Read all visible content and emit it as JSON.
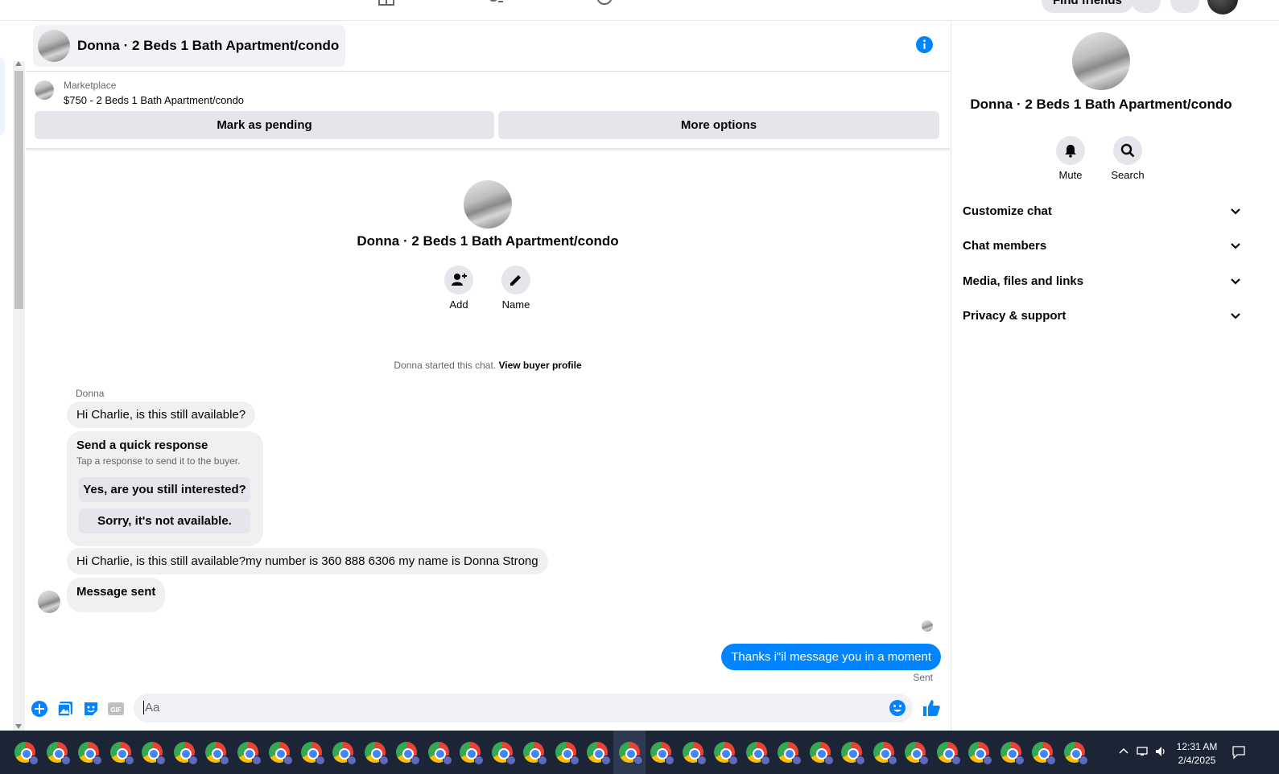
{
  "topbar": {
    "find_friends": "Find friends"
  },
  "header": {
    "title": "Donna · 2 Beds 1 Bath Apartment/condo"
  },
  "marketplace": {
    "label": "Marketplace",
    "listing": "$750 - 2 Beds 1 Bath Apartment/condo",
    "mark_pending": "Mark as pending",
    "more_options": "More options"
  },
  "intro": {
    "name": "Donna · 2 Beds 1 Bath Apartment/condo",
    "add_label": "Add",
    "name_label": "Name",
    "started_text": "Donna started this chat.",
    "view_profile": "View buyer profile"
  },
  "messages": {
    "sender": "Donna",
    "m1": "Hi Charlie, is this still available?",
    "quick_title": "Send a quick response",
    "quick_sub": "Tap a response to send it to the buyer.",
    "quick_opt1": "Yes, are you still interested?",
    "quick_opt2": "Sorry, it's not available.",
    "m2": "Hi Charlie, is this still available?my number is 360 888 6306 my name is Donna Strong",
    "m3": "Message sent",
    "outgoing": "Thanks i\"il message you in a moment",
    "status": "Sent"
  },
  "composer": {
    "placeholder": "Aa"
  },
  "right_panel": {
    "name": "Donna · 2 Beds 1 Bath Apartment/condo",
    "mute": "Mute",
    "search": "Search",
    "sections": [
      "Customize chat",
      "Chat members",
      "Media, files and links",
      "Privacy & support"
    ]
  },
  "taskbar": {
    "time": "12:31 AM",
    "date": "2/4/2025"
  },
  "colors": {
    "accent": "#0084ff",
    "bubble": "#f0f0f0",
    "button": "#e4e6eb"
  }
}
